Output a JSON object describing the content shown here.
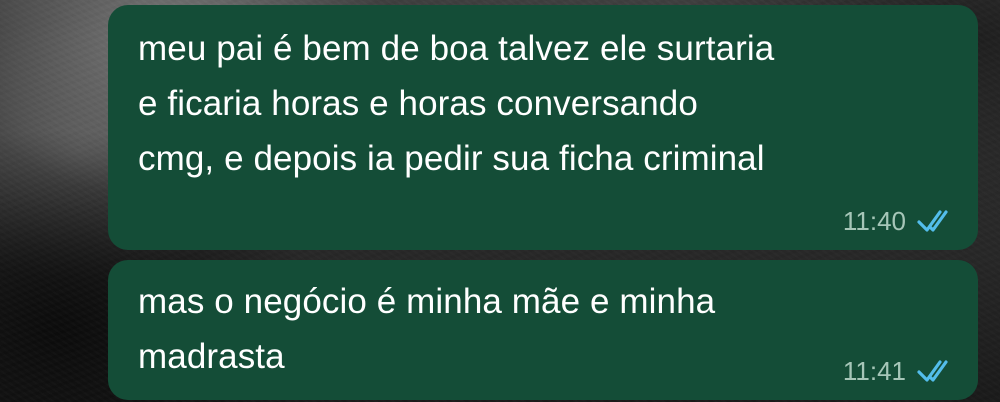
{
  "conversation": {
    "messages": [
      {
        "text": "meu pai é bem de boa talvez ele surtaria\ne ficaria horas e horas conversando\ncmg, e depois ia pedir sua ficha criminal",
        "time": "11:40",
        "status": "read",
        "status_icon": "double-check-icon"
      },
      {
        "text": "mas o negócio é minha mãe e minha\nmadrasta",
        "time": "11:41",
        "status": "read",
        "status_icon": "double-check-icon"
      }
    ]
  },
  "colors": {
    "bubble_bg": "#144d37",
    "message_text": "#ffffff",
    "timestamp": "#a6c6b8",
    "read_ticks": "#53bdeb"
  }
}
